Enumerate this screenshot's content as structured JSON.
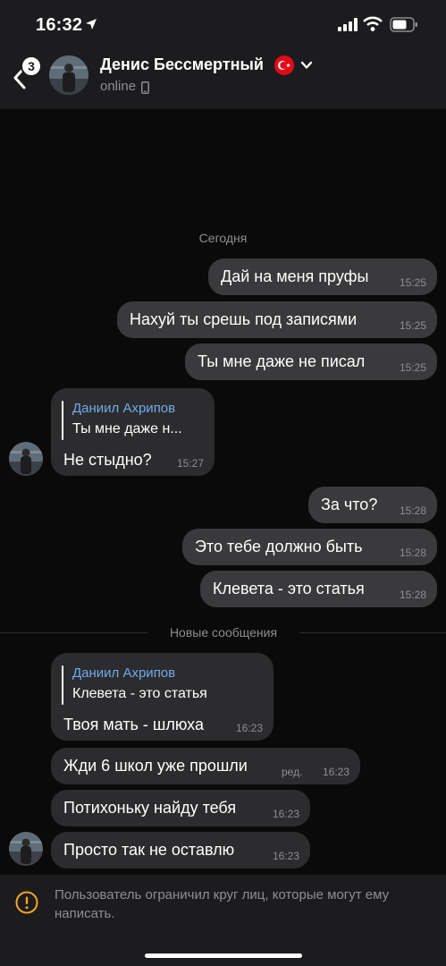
{
  "status_bar": {
    "time": "16:32"
  },
  "header": {
    "unread_count": "3",
    "name": "Денис Бессмертный",
    "status": "online"
  },
  "chat": {
    "date_separator": "Сегодня",
    "new_messages_separator": "Новые сообщения",
    "messages": [
      {
        "dir": "out",
        "text": "Дай на меня пруфы",
        "time": "15:25"
      },
      {
        "dir": "out",
        "text": "Нахуй ты срешь под записями",
        "time": "15:25"
      },
      {
        "dir": "out",
        "text": "Ты мне даже не писал",
        "time": "15:25"
      },
      {
        "dir": "in",
        "reply_name": "Даниил Ахрипов",
        "reply_text": "Ты мне даже н...",
        "text": "Не стыдно?",
        "time": "15:27"
      },
      {
        "dir": "out",
        "text": "За что?",
        "time": "15:28"
      },
      {
        "dir": "out",
        "text": "Это тебе должно быть",
        "time": "15:28"
      },
      {
        "dir": "out",
        "text": "Клевета - это статья",
        "time": "15:28"
      },
      {
        "dir": "in",
        "reply_name": "Даниил Ахрипов",
        "reply_text": "Клевета - это статья",
        "text": "Твоя мать - шлюха",
        "time": "16:23"
      },
      {
        "dir": "in",
        "text": "Жди 6 школ уже прошли",
        "edited": "ред.",
        "time": "16:23"
      },
      {
        "dir": "in",
        "text": "Потихоньку найду тебя",
        "time": "16:23"
      },
      {
        "dir": "in",
        "text": "Просто так не оставлю",
        "time": "16:23"
      }
    ]
  },
  "restriction": {
    "text": "Пользователь ограничил круг лиц, которые могут ему написать."
  },
  "colors": {
    "background": "#0a0a0a",
    "header": "#1c1c1e",
    "bubble_out": "#3a3a3c",
    "bubble_in": "#2c2c2e",
    "reply_name": "#71aaeb",
    "warning": "#f5a623"
  },
  "icons": [
    "location-arrow-icon",
    "signal-icon",
    "wifi-icon",
    "battery-icon",
    "back-chevron-icon",
    "turkey-flag-icon",
    "chevron-down-icon",
    "phone-icon",
    "warning-icon"
  ]
}
